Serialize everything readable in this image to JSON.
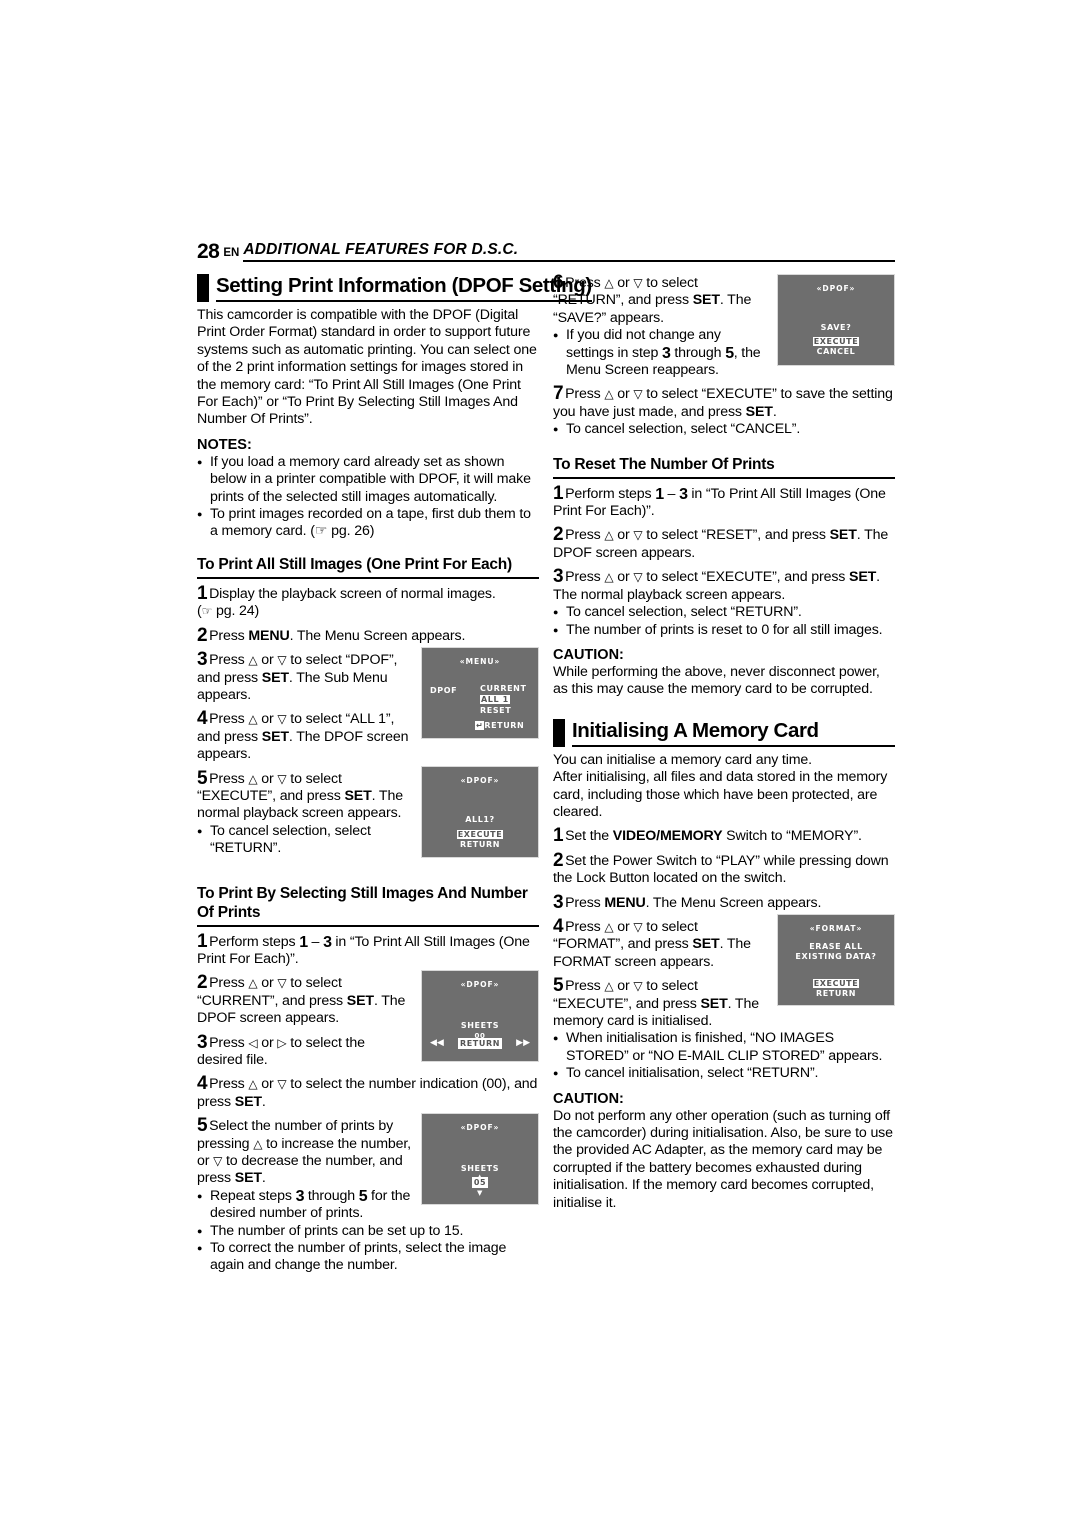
{
  "runhead": {
    "page_number": "28",
    "lang": "EN",
    "title": "ADDITIONAL FEATURES FOR D.S.C."
  },
  "left": {
    "section_title": "Setting Print Information (DPOF Setting)",
    "intro": "This camcorder is compatible with the DPOF (Digital Print Order Format) standard in order to support future systems such as automatic printing. You can select one of the 2 print information settings for images stored in the memory card: “To Print All Still Images (One Print For Each)” or “To Print By Selecting Still Images And Number Of Prints”.",
    "notes_label": "NOTES:",
    "notes": [
      "If you load a memory card already set as shown below in a printer compatible with DPOF, it will make prints of the selected still images automatically.",
      "To print images recorded on a tape, first dub them to a memory card. (☞ pg. 26)"
    ],
    "sub1_title": "To Print All Still Images (One Print For Each)",
    "sub1_steps": [
      {
        "num": "1",
        "text": "Display the playback screen of normal images. (☞ pg. 24)"
      },
      {
        "num": "2",
        "text": "Press MENU. The Menu Screen appears."
      },
      {
        "num": "3",
        "text": "Press △ or ▽ to select “DPOF”, and press SET. The Sub Menu appears."
      },
      {
        "num": "4",
        "text": "Press △ or ▽ to select “ALL 1”, and press SET. The DPOF screen appears."
      },
      {
        "num": "5",
        "text": "Press △ or ▽ to select “EXECUTE”, and press SET. The normal playback screen appears."
      }
    ],
    "sub1_note": "To cancel selection, select “RETURN”.",
    "sub2_title": "To Print By Selecting Still Images And Number Of Prints",
    "sub2_steps": [
      {
        "num": "1",
        "text": "Perform steps 1 – 3 in “To Print All Still Images (One Print For Each)”."
      },
      {
        "num": "2",
        "text": "Press △ or ▽ to select “CURRENT”, and press SET. The DPOF screen appears."
      },
      {
        "num": "3",
        "text": "Press ◁ or ▷ to select the desired file."
      },
      {
        "num": "4",
        "text": "Press △ or ▽ to select the number indication (00), and press SET."
      },
      {
        "num": "5",
        "text": "Select the number of prints by pressing △ to increase the number, or ▽ to decrease the number, and press SET."
      }
    ],
    "sub2_notes": [
      "Repeat steps 3 through 5 for the desired number of prints.",
      "The number of prints can be set up to 15.",
      "To correct the number of prints, select the image again and change the number."
    ]
  },
  "right": {
    "steps_cont": [
      {
        "num": "6",
        "text": "Press △ or ▽ to select “RETURN”, and press SET. The “SAVE?” appears."
      },
      {
        "num": "7",
        "text": "Press △ or ▽ to select “EXECUTE” to save the setting you have just made, and press SET."
      }
    ],
    "step6_note": "If you did not change any settings in step 3 through 5, the Menu Screen reappears.",
    "step7_note": "To cancel selection, select “CANCEL”.",
    "sub3_title": "To Reset The Number Of Prints",
    "sub3_steps": [
      {
        "num": "1",
        "text": "Perform steps 1 – 3 in “To Print All Still Images (One Print For Each)”."
      },
      {
        "num": "2",
        "text": "Press △ or ▽ to select “RESET”, and press SET. The DPOF screen appears."
      },
      {
        "num": "3",
        "text": "Press △ or ▽ to select “EXECUTE”, and press SET. The normal playback screen appears."
      }
    ],
    "sub3_notes": [
      "To cancel selection, select “RETURN”.",
      "The number of prints is reset to 0 for all still images."
    ],
    "caution1_label": "CAUTION:",
    "caution1_text": "While performing the above, never disconnect power, as this may cause the memory card to be corrupted.",
    "section2_title": "Initialising A Memory Card",
    "section2_intro": "You can initialise a memory card any time. After initialising, all files and data stored in the memory card, including those which have been protected, are cleared.",
    "section2_steps": [
      {
        "num": "1",
        "text": "Set the VIDEO/MEMORY Switch to “MEMORY”."
      },
      {
        "num": "2",
        "text": "Set the Power Switch to “PLAY” while pressing down the Lock Button located on the switch."
      },
      {
        "num": "3",
        "text": "Press MENU. The Menu Screen appears."
      },
      {
        "num": "4",
        "text": "Press △ or ▽ to select “FORMAT”, and press SET. The FORMAT screen appears."
      },
      {
        "num": "5",
        "text": "Press △ or ▽ to select “EXECUTE”, and press SET. The memory card is initialised."
      }
    ],
    "section2_notes": [
      "When initialisation is finished, “NO IMAGES STORED” or “NO E-MAIL CLIP STORED” appears.",
      "To cancel initialisation, select “RETURN”."
    ],
    "caution2_label": "CAUTION:",
    "caution2_text": "Do not perform any other operation (such as turning off the camcorder) during initialisation. Also, be sure to use the provided AC Adapter, as the memory card may be corrupted if the battery becomes exhausted during initialisation. If the memory card becomes corrupted, initialise it."
  },
  "screens": {
    "menu": {
      "title": "«MENU»",
      "left_label": "DPOF",
      "items": [
        "CURRENT",
        "ALL 1",
        "RESET"
      ],
      "selected": "ALL 1",
      "return": "RETURN",
      "return_icon": "↵"
    },
    "dpof_all1": {
      "title": "«DPOF»",
      "prompt": "ALL1?",
      "options": [
        "EXECUTE",
        "RETURN"
      ],
      "selected": "EXECUTE"
    },
    "dpof_sheets_00": {
      "title": "«DPOF»",
      "label": "SHEETS",
      "value": "00",
      "option": "RETURN",
      "selected": "RETURN",
      "left_arrow": "◀◀",
      "right_arrow": "▶▶"
    },
    "dpof_sheets_05": {
      "title": "«DPOF»",
      "label": "SHEETS",
      "value": "05",
      "up_arrow": "▲",
      "down_arrow": "▼"
    },
    "dpof_save": {
      "title": "«DPOF»",
      "prompt": "SAVE?",
      "options": [
        "EXECUTE",
        "CANCEL"
      ],
      "selected": "EXECUTE"
    },
    "format": {
      "title": "«FORMAT»",
      "prompt_line1": "ERASE ALL",
      "prompt_line2": "EXISTING DATA?",
      "options": [
        "EXECUTE",
        "RETURN"
      ],
      "selected": "EXECUTE"
    }
  },
  "colors": {
    "screen_bg": "#6e6e6e",
    "screen_border": "#d9d9d9",
    "screen_text": "#ffffff",
    "ink": "#000000"
  }
}
